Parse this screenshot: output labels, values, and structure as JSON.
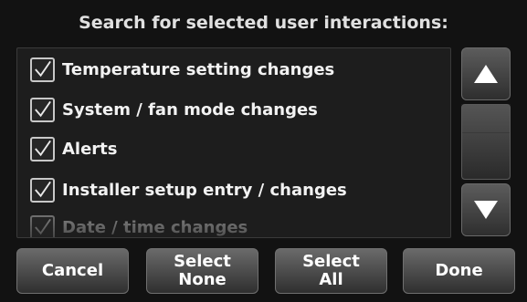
{
  "header": {
    "title": "Search for selected user interactions:"
  },
  "list": {
    "items": [
      {
        "label": "Temperature setting changes",
        "checked": true
      },
      {
        "label": "System / fan mode changes",
        "checked": true
      },
      {
        "label": "Alerts",
        "checked": true
      },
      {
        "label": "Installer setup entry / changes",
        "checked": true
      },
      {
        "label": "Date / time changes",
        "checked": true
      }
    ]
  },
  "scrollbar": {
    "up_icon": "triangle-up",
    "down_icon": "triangle-down"
  },
  "footer": {
    "cancel_label": "Cancel",
    "select_none": {
      "line1": "Select",
      "line2": "None"
    },
    "select_all": {
      "line1": "Select",
      "line2": "All"
    },
    "done_label": "Done"
  },
  "colors": {
    "background": "#121212",
    "text": "#ffffff",
    "button_top": "#6a6a6a",
    "button_bottom": "#2f2f2f"
  }
}
